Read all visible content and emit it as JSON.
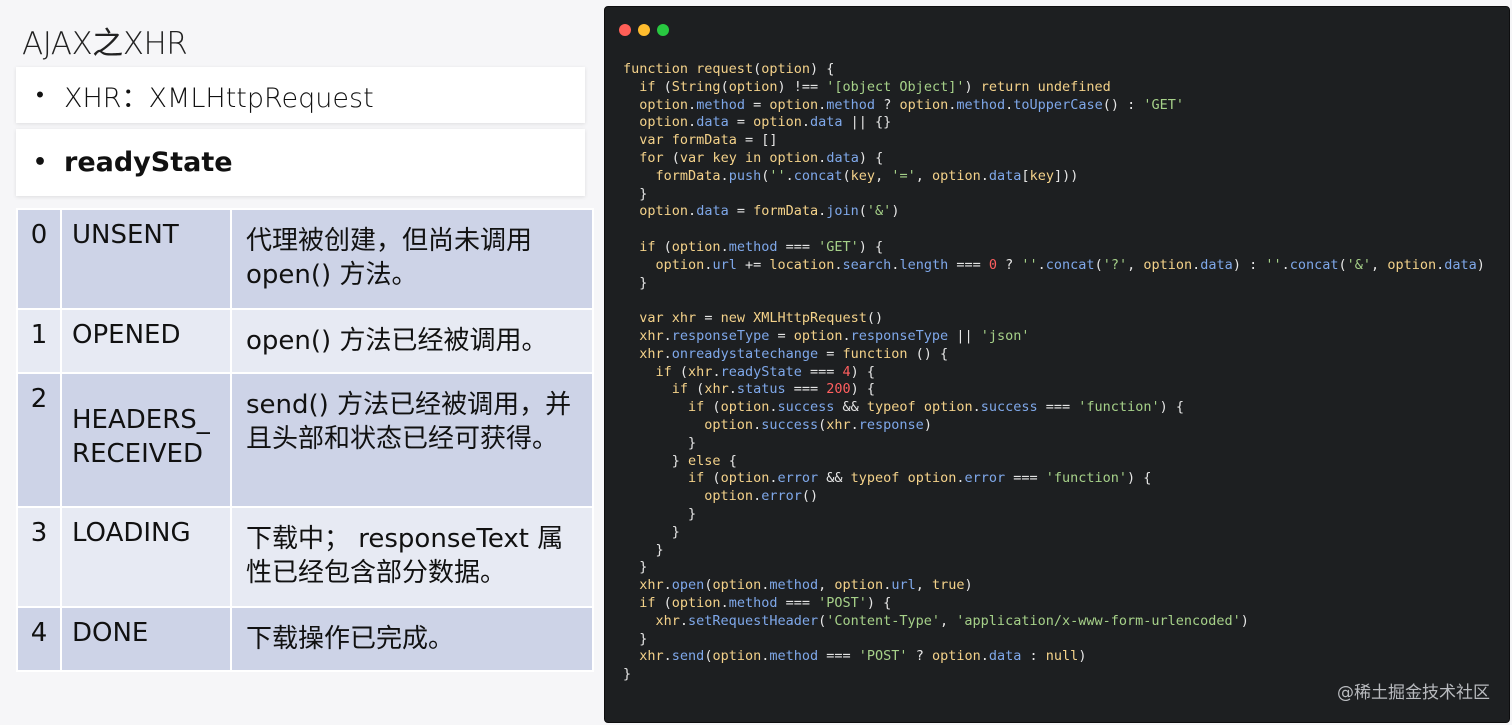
{
  "slide": {
    "title": "AJAX之XHR",
    "bullets": [
      "XHR：XMLHttpRequest",
      "readyState"
    ],
    "bullet_mark": "•"
  },
  "states": [
    {
      "num": "0",
      "name": "UNSENT",
      "desc": "代理被创建，但尚未调用open() 方法。"
    },
    {
      "num": "1",
      "name": "OPENED",
      "desc": "open() 方法已经被调用。"
    },
    {
      "num": "2",
      "name": "HEADERS_ RECEIVED",
      "desc": "send() 方法已经被调用，并且头部和状态已经可获得。"
    },
    {
      "num": "3",
      "name": "LOADING",
      "desc": "下载中； responseText 属性已经包含部分数据。"
    },
    {
      "num": "4",
      "name": "DONE",
      "desc": "下载操作已完成。"
    }
  ],
  "editor": {
    "code": [
      "function request(option) {",
      "  if (String(option) !== '[object Object]') return undefined",
      "  option.method = option.method ? option.method.toUpperCase() : 'GET'",
      "  option.data = option.data || {}",
      "  var formData = []",
      "  for (var key in option.data) {",
      "    formData.push(''.concat(key, '=', option.data[key]))",
      "  }",
      "  option.data = formData.join('&')",
      "",
      "  if (option.method === 'GET') {",
      "    option.url += location.search.length === 0 ? ''.concat('?', option.data) : ''.concat('&', option.data)",
      "  }",
      "",
      "  var xhr = new XMLHttpRequest()",
      "  xhr.responseType = option.responseType || 'json'",
      "  xhr.onreadystatechange = function () {",
      "    if (xhr.readyState === 4) {",
      "      if (xhr.status === 200) {",
      "        if (option.success && typeof option.success === 'function') {",
      "          option.success(xhr.response)",
      "        }",
      "      } else {",
      "        if (option.error && typeof option.error === 'function') {",
      "          option.error()",
      "        }",
      "      }",
      "    }",
      "  }",
      "  xhr.open(option.method, option.url, true)",
      "  if (option.method === 'POST') {",
      "    xhr.setRequestHeader('Content-Type', 'application/x-www-form-urlencoded')",
      "  }",
      "  xhr.send(option.method === 'POST' ? option.data : null)",
      "}"
    ]
  },
  "watermark": "@稀土掘金技术社区",
  "colors": {
    "editor_bg": "#1d1f21",
    "keyword": "#f4d28a",
    "identifier": "#7fa8ea",
    "string": "#a6d189",
    "number": "#ff5f5f",
    "table_dark_row": "#cdd3e7",
    "table_light_row": "#e7eaf3"
  },
  "icons": [
    "close-dot-icon",
    "minimize-dot-icon",
    "maximize-dot-icon"
  ]
}
